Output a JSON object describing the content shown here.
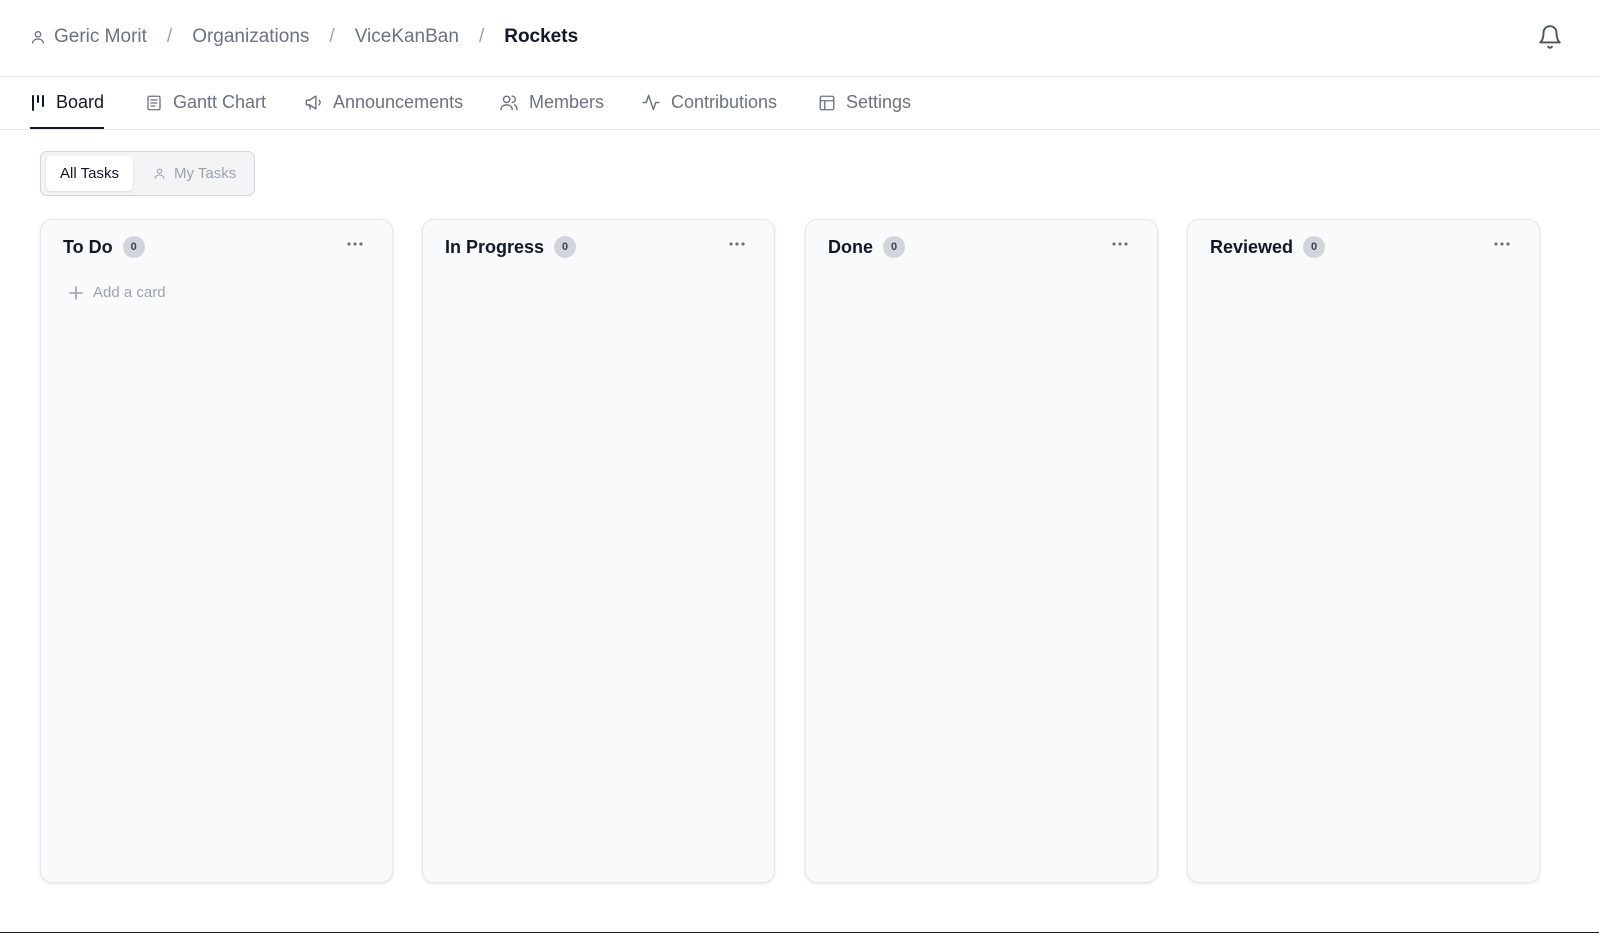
{
  "breadcrumb": {
    "user": "Geric Morit",
    "organizations": "Organizations",
    "org": "ViceKanBan",
    "project": "Rockets",
    "separator": "/"
  },
  "icons": {
    "user": "user-icon",
    "notifications": "bell-icon",
    "board": "kanban-icon",
    "gantt": "document-icon",
    "announcements": "megaphone-icon",
    "members": "users-icon",
    "contributions": "activity-icon",
    "settings": "layout-icon",
    "column_menu": "more-horizontal-icon",
    "add": "plus-icon"
  },
  "tabs": [
    {
      "label": "Board",
      "active": true
    },
    {
      "label": "Gantt Chart",
      "active": false
    },
    {
      "label": "Announcements",
      "active": false
    },
    {
      "label": "Members",
      "active": false
    },
    {
      "label": "Contributions",
      "active": false
    },
    {
      "label": "Settings",
      "active": false
    }
  ],
  "filter": {
    "all_tasks": "All Tasks",
    "my_tasks": "My Tasks",
    "selected": "All Tasks"
  },
  "columns": [
    {
      "title": "To Do",
      "count": "0",
      "add_card_label": "Add a card"
    },
    {
      "title": "In Progress",
      "count": "0"
    },
    {
      "title": "Done",
      "count": "0"
    },
    {
      "title": "Reviewed",
      "count": "0"
    }
  ],
  "colors": {
    "text_primary": "#111827",
    "text_muted": "#6b7280",
    "column_bg": "#f9fafb",
    "badge_bg": "#d1d5db"
  }
}
